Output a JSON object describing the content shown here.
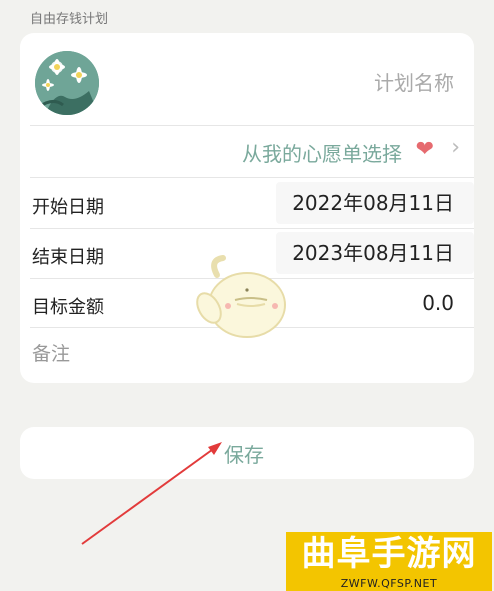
{
  "theme": {
    "bg": "#f2f2ef",
    "accent": "#7aa99c",
    "heart": "#e66a6f"
  },
  "section_label": "自由存钱计划",
  "plan": {
    "avatar_icon": "flower-photo",
    "name_placeholder": "计划名称"
  },
  "wish": {
    "label": "从我的心愿单选择",
    "heart_glyph": "❤",
    "chevron_glyph": "›"
  },
  "form": {
    "start": {
      "label": "开始日期",
      "value": "2022年08月11日"
    },
    "end": {
      "label": "结束日期",
      "value": "2023年08月11日"
    },
    "amount": {
      "label": "目标金额",
      "value": "0.0"
    },
    "note": {
      "label": "备注"
    }
  },
  "actions": {
    "save": "保存"
  },
  "watermark": {
    "title": "曲阜手游网",
    "subtitle": "ZWFW.QFSP.NET"
  }
}
